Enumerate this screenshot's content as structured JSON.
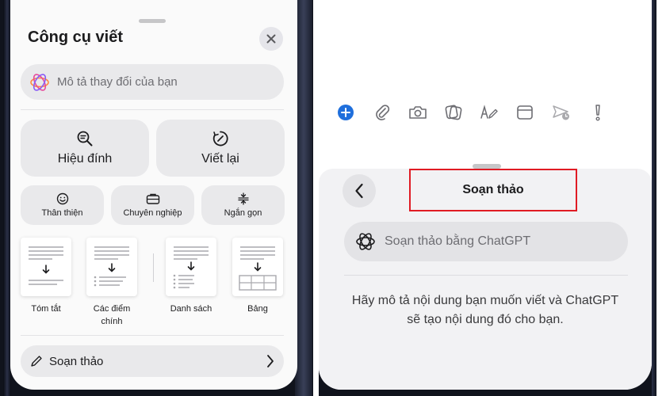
{
  "left_panel": {
    "title": "Công cụ viết",
    "input_placeholder": "Mô tả thay đổi của bạn",
    "actions": [
      {
        "label": "Hiệu đính",
        "icon": "magnifier-text-icon"
      },
      {
        "label": "Viết lại",
        "icon": "rewrite-circle-icon"
      }
    ],
    "tones": [
      {
        "label": "Thân thiện",
        "icon": "smiley-icon"
      },
      {
        "label": "Chuyên nghiệp",
        "icon": "briefcase-icon"
      },
      {
        "label": "Ngắn gọn",
        "icon": "condense-icon"
      }
    ],
    "formats": [
      {
        "line1": "Tóm tắt",
        "line2": "",
        "icon": "summary-doc-icon"
      },
      {
        "line1": "Các điểm",
        "line2": "chính",
        "icon": "key-points-doc-icon"
      },
      {
        "line1": "Danh sách",
        "line2": "",
        "icon": "list-doc-icon"
      },
      {
        "line1": "Bảng",
        "line2": "",
        "icon": "table-doc-icon"
      }
    ],
    "compose_label": "Soạn thảo"
  },
  "right_panel": {
    "toolbar_icons": [
      "plus-circle-icon",
      "paperclip-icon",
      "camera-icon",
      "image-stack-icon",
      "handwriting-icon",
      "window-icon",
      "schedule-send-icon",
      "exclamation-icon"
    ],
    "title": "Soạn thảo",
    "input_placeholder": "Soạn thảo bằng ChatGPT",
    "description": "Hãy mô tả nội dung bạn muốn viết và ChatGPT sẽ tạo nội dung đó cho bạn."
  },
  "colors": {
    "accent_blue": "#1f6fdc",
    "highlight_red": "#e01b24",
    "sheet_bg": "#fafafa",
    "button_bg": "#e9e9eb",
    "frame_dark": "#10131c"
  }
}
